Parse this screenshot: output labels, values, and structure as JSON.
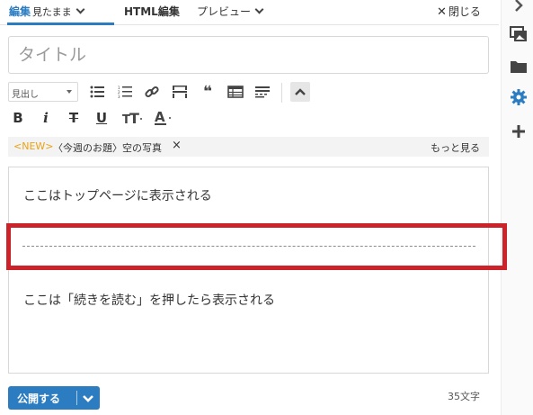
{
  "tabs": {
    "edit_main": "編集",
    "edit_sub": "見たまま",
    "html": "HTML編集",
    "preview": "プレビュー",
    "close": "閉じる"
  },
  "title_input": {
    "placeholder": "タイトル",
    "value": ""
  },
  "toolbar": {
    "heading_select": "見出し"
  },
  "tags": {
    "new_badge": "<NEW>",
    "topic": "〈今週のお題〉空の写真",
    "more": "もっと見る"
  },
  "editor": {
    "para_top": "ここはトップページに表示される",
    "para_after_more": "ここは「続きを読む」を押したら表示される"
  },
  "footer": {
    "publish": "公開する",
    "char_count": "35文字"
  },
  "colors": {
    "accent": "#2b7cc0",
    "highlight": "#cc2229",
    "new_badge": "#e8a317"
  },
  "sidebar_icons": [
    "chevron-right-icon",
    "images-icon",
    "folder-icon",
    "gear-icon",
    "plus-icon"
  ]
}
